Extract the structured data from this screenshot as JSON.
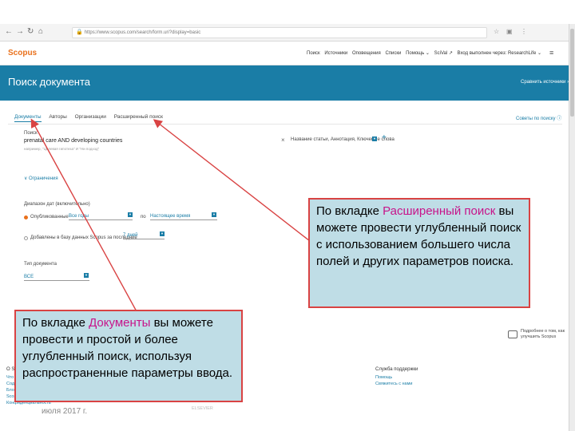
{
  "browser": {
    "address": "https://www.scopus.com/search/form.uri?display=basic",
    "icons": [
      "back-icon",
      "forward-icon",
      "reload-icon",
      "home-icon",
      "lock-icon",
      "star-icon",
      "menu-icon"
    ]
  },
  "header": {
    "logo": "Scopus",
    "nav": [
      "Поиск",
      "Источники",
      "Оповещения",
      "Списки",
      "Помощь ⌄",
      "SciVal ↗",
      "Вход выполнен через: ResearchLife ⌄"
    ]
  },
  "title_bar": {
    "title": "Поиск документа",
    "compare_link": "Сравнить источники ›"
  },
  "tabs": {
    "items": [
      "Документы",
      "Авторы",
      "Организации",
      "Расширенный поиск"
    ],
    "active_index": 0,
    "search_tips": "Советы по поиску ⓘ"
  },
  "search": {
    "label": "Поиск",
    "value": "prenatal care AND developing countries",
    "hint": "например, \"Целевая гипотеза\" И \"Ни подход\"",
    "field_select": "Название статьи, Аннотация, Ключевые слова",
    "add_button": "+"
  },
  "limits": {
    "toggle": "∨ Ограничения",
    "date_range_label": "Диапазон дат (включительно)",
    "published_label": "Опубликованные",
    "from_value": "Все годы",
    "to_sep": "по",
    "to_value": "Настоящее время",
    "added_label": "Добавлены в базу данных Scopus за последние",
    "added_value": "7 дней",
    "doc_type_label": "Тип документа",
    "doc_type_value": "ВСЕ"
  },
  "feedback": "Подробнее о том, как улучшить Scopus",
  "footer": {
    "col1": [
      "О Scopus",
      "Что такое Scopus",
      "Содержание",
      "Блог Scopus",
      "Scopus API",
      "Конфиденциальность"
    ],
    "col2": {
      "head": "Служба поддержки",
      "links": [
        "Помощь",
        "Свяжитесь с нами"
      ]
    },
    "col3": [
      "ELSEVIER"
    ]
  },
  "date_stamp": "июля 2017 г.",
  "callouts": {
    "right": {
      "pre": "По вкладке ",
      "highlight": "Расширенный поиск",
      "post": " вы можете провести углубленный поиск с использованием большего числа полей и других параметров поиска."
    },
    "left": {
      "pre": "По вкладке ",
      "highlight": "Документы",
      "post": " вы можете провести и простой и более углубленный поиск, используя распространенные параметры ввода."
    }
  },
  "colors": {
    "accent": "#1a7da6",
    "brand": "#e9711c",
    "callout_bg": "#bfdde6",
    "callout_border": "#d94343",
    "highlight": "#c7148a"
  }
}
